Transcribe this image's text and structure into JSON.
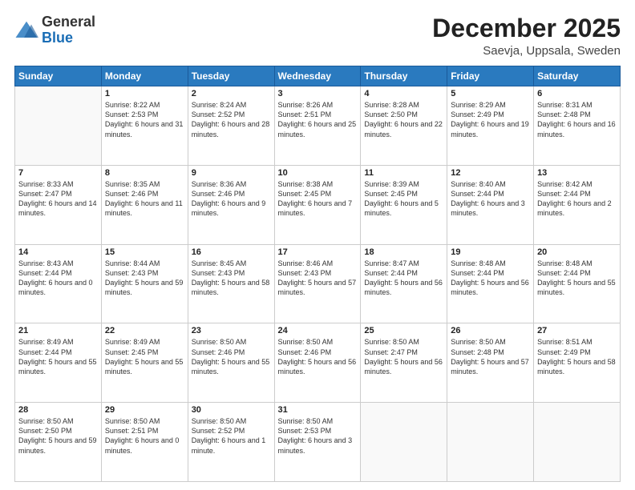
{
  "logo": {
    "general": "General",
    "blue": "Blue"
  },
  "header": {
    "month": "December 2025",
    "location": "Saevja, Uppsala, Sweden"
  },
  "weekdays": [
    "Sunday",
    "Monday",
    "Tuesday",
    "Wednesday",
    "Thursday",
    "Friday",
    "Saturday"
  ],
  "weeks": [
    [
      {
        "day": "",
        "sunrise": "",
        "sunset": "",
        "daylight": ""
      },
      {
        "day": "1",
        "sunrise": "Sunrise: 8:22 AM",
        "sunset": "Sunset: 2:53 PM",
        "daylight": "Daylight: 6 hours and 31 minutes."
      },
      {
        "day": "2",
        "sunrise": "Sunrise: 8:24 AM",
        "sunset": "Sunset: 2:52 PM",
        "daylight": "Daylight: 6 hours and 28 minutes."
      },
      {
        "day": "3",
        "sunrise": "Sunrise: 8:26 AM",
        "sunset": "Sunset: 2:51 PM",
        "daylight": "Daylight: 6 hours and 25 minutes."
      },
      {
        "day": "4",
        "sunrise": "Sunrise: 8:28 AM",
        "sunset": "Sunset: 2:50 PM",
        "daylight": "Daylight: 6 hours and 22 minutes."
      },
      {
        "day": "5",
        "sunrise": "Sunrise: 8:29 AM",
        "sunset": "Sunset: 2:49 PM",
        "daylight": "Daylight: 6 hours and 19 minutes."
      },
      {
        "day": "6",
        "sunrise": "Sunrise: 8:31 AM",
        "sunset": "Sunset: 2:48 PM",
        "daylight": "Daylight: 6 hours and 16 minutes."
      }
    ],
    [
      {
        "day": "7",
        "sunrise": "Sunrise: 8:33 AM",
        "sunset": "Sunset: 2:47 PM",
        "daylight": "Daylight: 6 hours and 14 minutes."
      },
      {
        "day": "8",
        "sunrise": "Sunrise: 8:35 AM",
        "sunset": "Sunset: 2:46 PM",
        "daylight": "Daylight: 6 hours and 11 minutes."
      },
      {
        "day": "9",
        "sunrise": "Sunrise: 8:36 AM",
        "sunset": "Sunset: 2:46 PM",
        "daylight": "Daylight: 6 hours and 9 minutes."
      },
      {
        "day": "10",
        "sunrise": "Sunrise: 8:38 AM",
        "sunset": "Sunset: 2:45 PM",
        "daylight": "Daylight: 6 hours and 7 minutes."
      },
      {
        "day": "11",
        "sunrise": "Sunrise: 8:39 AM",
        "sunset": "Sunset: 2:45 PM",
        "daylight": "Daylight: 6 hours and 5 minutes."
      },
      {
        "day": "12",
        "sunrise": "Sunrise: 8:40 AM",
        "sunset": "Sunset: 2:44 PM",
        "daylight": "Daylight: 6 hours and 3 minutes."
      },
      {
        "day": "13",
        "sunrise": "Sunrise: 8:42 AM",
        "sunset": "Sunset: 2:44 PM",
        "daylight": "Daylight: 6 hours and 2 minutes."
      }
    ],
    [
      {
        "day": "14",
        "sunrise": "Sunrise: 8:43 AM",
        "sunset": "Sunset: 2:44 PM",
        "daylight": "Daylight: 6 hours and 0 minutes."
      },
      {
        "day": "15",
        "sunrise": "Sunrise: 8:44 AM",
        "sunset": "Sunset: 2:43 PM",
        "daylight": "Daylight: 5 hours and 59 minutes."
      },
      {
        "day": "16",
        "sunrise": "Sunrise: 8:45 AM",
        "sunset": "Sunset: 2:43 PM",
        "daylight": "Daylight: 5 hours and 58 minutes."
      },
      {
        "day": "17",
        "sunrise": "Sunrise: 8:46 AM",
        "sunset": "Sunset: 2:43 PM",
        "daylight": "Daylight: 5 hours and 57 minutes."
      },
      {
        "day": "18",
        "sunrise": "Sunrise: 8:47 AM",
        "sunset": "Sunset: 2:44 PM",
        "daylight": "Daylight: 5 hours and 56 minutes."
      },
      {
        "day": "19",
        "sunrise": "Sunrise: 8:48 AM",
        "sunset": "Sunset: 2:44 PM",
        "daylight": "Daylight: 5 hours and 56 minutes."
      },
      {
        "day": "20",
        "sunrise": "Sunrise: 8:48 AM",
        "sunset": "Sunset: 2:44 PM",
        "daylight": "Daylight: 5 hours and 55 minutes."
      }
    ],
    [
      {
        "day": "21",
        "sunrise": "Sunrise: 8:49 AM",
        "sunset": "Sunset: 2:44 PM",
        "daylight": "Daylight: 5 hours and 55 minutes."
      },
      {
        "day": "22",
        "sunrise": "Sunrise: 8:49 AM",
        "sunset": "Sunset: 2:45 PM",
        "daylight": "Daylight: 5 hours and 55 minutes."
      },
      {
        "day": "23",
        "sunrise": "Sunrise: 8:50 AM",
        "sunset": "Sunset: 2:46 PM",
        "daylight": "Daylight: 5 hours and 55 minutes."
      },
      {
        "day": "24",
        "sunrise": "Sunrise: 8:50 AM",
        "sunset": "Sunset: 2:46 PM",
        "daylight": "Daylight: 5 hours and 56 minutes."
      },
      {
        "day": "25",
        "sunrise": "Sunrise: 8:50 AM",
        "sunset": "Sunset: 2:47 PM",
        "daylight": "Daylight: 5 hours and 56 minutes."
      },
      {
        "day": "26",
        "sunrise": "Sunrise: 8:50 AM",
        "sunset": "Sunset: 2:48 PM",
        "daylight": "Daylight: 5 hours and 57 minutes."
      },
      {
        "day": "27",
        "sunrise": "Sunrise: 8:51 AM",
        "sunset": "Sunset: 2:49 PM",
        "daylight": "Daylight: 5 hours and 58 minutes."
      }
    ],
    [
      {
        "day": "28",
        "sunrise": "Sunrise: 8:50 AM",
        "sunset": "Sunset: 2:50 PM",
        "daylight": "Daylight: 5 hours and 59 minutes."
      },
      {
        "day": "29",
        "sunrise": "Sunrise: 8:50 AM",
        "sunset": "Sunset: 2:51 PM",
        "daylight": "Daylight: 6 hours and 0 minutes."
      },
      {
        "day": "30",
        "sunrise": "Sunrise: 8:50 AM",
        "sunset": "Sunset: 2:52 PM",
        "daylight": "Daylight: 6 hours and 1 minute."
      },
      {
        "day": "31",
        "sunrise": "Sunrise: 8:50 AM",
        "sunset": "Sunset: 2:53 PM",
        "daylight": "Daylight: 6 hours and 3 minutes."
      },
      {
        "day": "",
        "sunrise": "",
        "sunset": "",
        "daylight": ""
      },
      {
        "day": "",
        "sunrise": "",
        "sunset": "",
        "daylight": ""
      },
      {
        "day": "",
        "sunrise": "",
        "sunset": "",
        "daylight": ""
      }
    ]
  ]
}
